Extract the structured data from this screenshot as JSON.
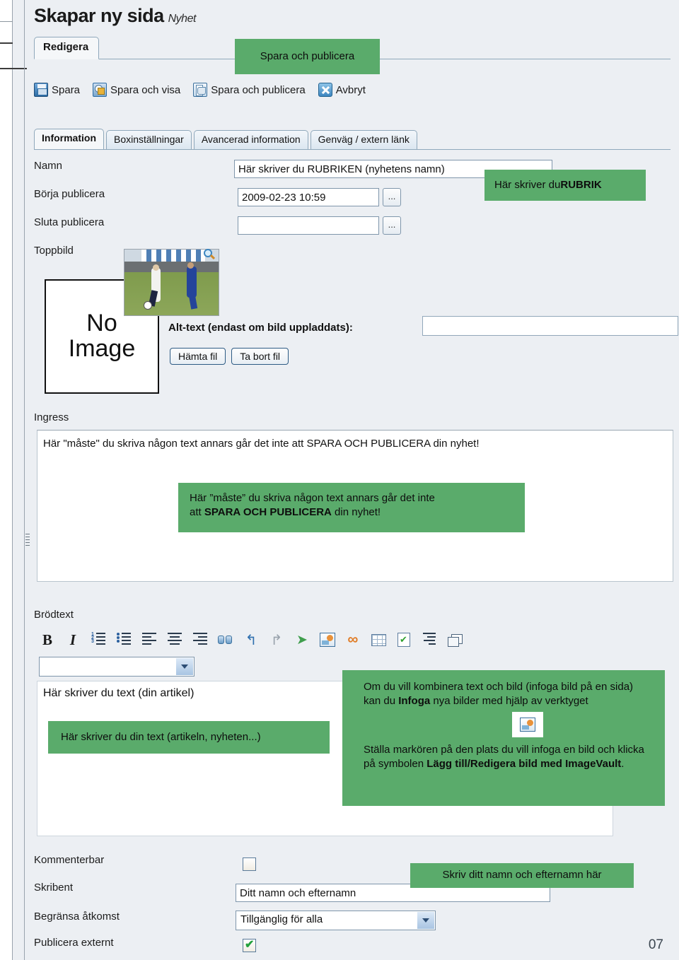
{
  "header": {
    "title": "Skapar ny sida",
    "subtitle": "Nyhet"
  },
  "main_tab": {
    "label": "Redigera"
  },
  "commands": [
    {
      "label": "Spara",
      "icon": "floppy-disk-icon"
    },
    {
      "label": "Spara och visa",
      "icon": "save-and-view-icon"
    },
    {
      "label": "Spara och publicera",
      "icon": "save-and-publish-icon"
    },
    {
      "label": "Avbryt",
      "icon": "cancel-x-icon"
    }
  ],
  "inner_tabs": [
    {
      "label": "Information",
      "active": true
    },
    {
      "label": "Boxinställningar",
      "active": false
    },
    {
      "label": "Avancerad information",
      "active": false
    },
    {
      "label": "Genväg / extern länk",
      "active": false
    }
  ],
  "fields": {
    "namn_label": "Namn",
    "namn_value": "Här skriver du RUBRIKEN (nyhetens namn)",
    "borja_label": "Börja publicera",
    "borja_value": "2009-02-23 10:59",
    "sluta_label": "Sluta publicera",
    "sluta_value": "",
    "ellipsis": "...",
    "toppbild_label": "Toppbild",
    "no_image_line1": "No",
    "no_image_line2": "Image",
    "alttext_label": "Alt-text (endast om bild uppladdats):",
    "alttext_value": "",
    "hamta_fil": "Hämta fil",
    "ta_bort_fil": "Ta bort fil"
  },
  "ingress": {
    "label": "Ingress",
    "text": "Här \"måste\" du skriva någon text annars går det inte att SPARA OCH PUBLICERA din nyhet!"
  },
  "brodtext": {
    "label": "Brödtext",
    "style_value": "",
    "body_text": "Här skriver du text (din artikel)",
    "toolbar": [
      "bold-icon",
      "italic-icon",
      "numbered-list-icon",
      "bulleted-list-icon",
      "align-left-icon",
      "align-center-icon",
      "align-right-icon",
      "find-binoculars-icon",
      "undo-icon",
      "redo-icon",
      "paste-cursor-icon",
      "insert-image-icon",
      "insert-link-icon",
      "insert-table-icon",
      "spellcheck-icon",
      "indent-icon",
      "new-window-icon"
    ]
  },
  "bottom": {
    "kommenterbar_label": "Kommenterbar",
    "kommenterbar_checked": false,
    "skribent_label": "Skribent",
    "skribent_value": "Ditt namn och efternamn",
    "begransa_label": "Begränsa åtkomst",
    "begransa_value": "Tillgänglig för alla",
    "publicera_label": "Publicera externt",
    "publicera_checked": true
  },
  "callouts": {
    "spara_publicera": "Spara och publicera",
    "rubrik_pre": "Här skriver du ",
    "rubrik_bold": "RUBRIK",
    "ingress_line1": "Här ”måste” du skriva någon text annars går det inte",
    "ingress_line2_pre": "att ",
    "ingress_line2_bold": "SPARA OCH PUBLICERA",
    "ingress_line2_post": " din nyhet!",
    "body_text": "Här skriver du din text (artikeln, nyheten...)",
    "image_p1_a": "Om du vill kombinera text och bild (infoga bild på en sida) kan du ",
    "image_p1_b": "Infoga",
    "image_p1_c": " nya bilder med hjälp av verktyget",
    "image_p2_a": "Ställa markören på den plats du vill infoga en bild och klicka på symbolen ",
    "image_p2_b": "Lägg till/Redigera bild med ImageVault",
    "image_p2_c": ".",
    "skribent": "Skriv ditt namn och efternamn här"
  },
  "page_number": "07",
  "colors": {
    "callout_green": "#5aab6b",
    "page_bg": "#eceff3"
  }
}
